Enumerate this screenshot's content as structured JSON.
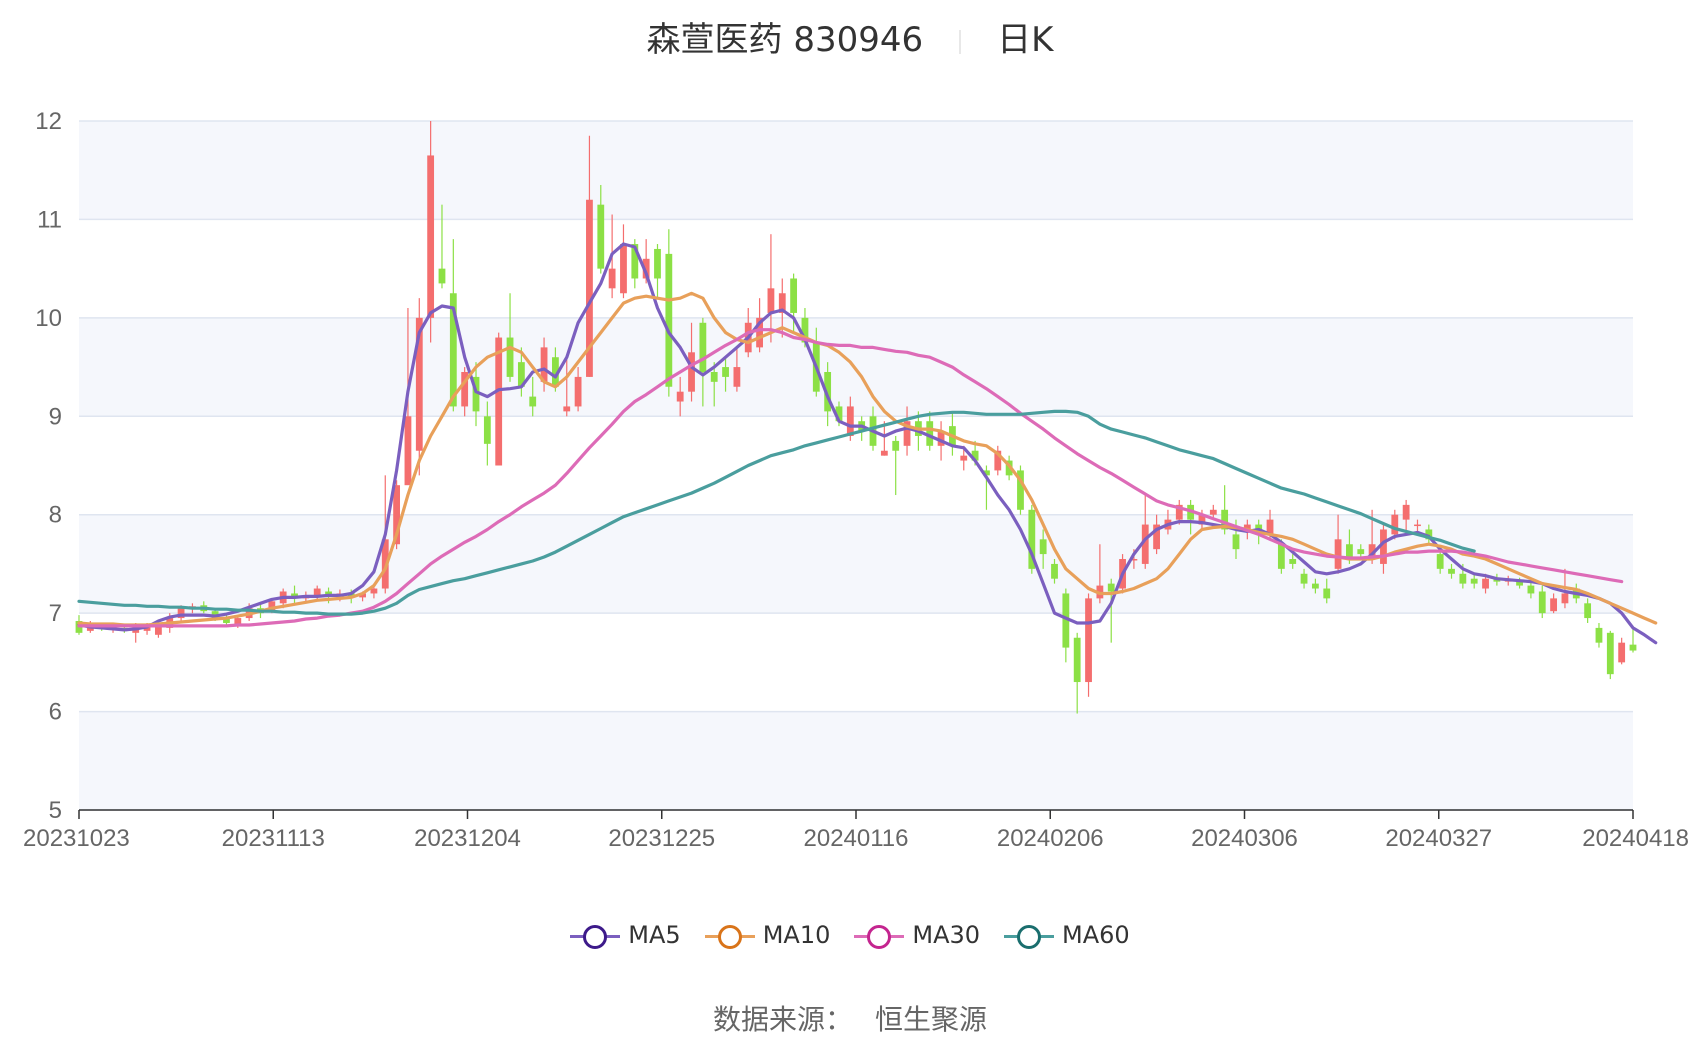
{
  "header": {
    "title": "森萱医药 830946",
    "subtitle": "日K"
  },
  "source": {
    "label": "数据来源：",
    "name": "恒生聚源"
  },
  "colors": {
    "up": "#f46e6e",
    "down": "#8ce045",
    "grid": "#dfe5f0",
    "band": "#f5f7fc",
    "axis": "#666666"
  },
  "chart_data": {
    "type": "candlestick",
    "y_ticks": [
      "5",
      "6",
      "7",
      "8",
      "9",
      "10",
      "11",
      "12"
    ],
    "ylim": [
      5,
      12
    ],
    "x_tick_labels": [
      "20231023",
      "20231113",
      "20231204",
      "20231225",
      "20240116",
      "20240206",
      "20240306",
      "20240327",
      "20240418"
    ],
    "legend": [
      "MA5",
      "MA10",
      "MA30",
      "MA60"
    ],
    "legend_position": "bottom",
    "series_colors": {
      "MA5": "#7b5fbf",
      "MA10": "#e8a05a",
      "MA30": "#dd6bb7",
      "MA60": "#4a9e9e"
    },
    "legend_ring_colors": {
      "MA5": "#3d1a8a",
      "MA10": "#d9741a",
      "MA30": "#c4258f",
      "MA60": "#1a6e6e"
    },
    "candles": [
      [
        6.92,
        6.8,
        6.98,
        6.78
      ],
      [
        6.82,
        6.88,
        6.92,
        6.8
      ],
      [
        6.86,
        6.84,
        6.9,
        6.82
      ],
      [
        6.84,
        6.86,
        6.9,
        6.8
      ],
      [
        6.85,
        6.83,
        6.88,
        6.8
      ],
      [
        6.8,
        6.85,
        6.9,
        6.7
      ],
      [
        6.82,
        6.86,
        6.9,
        6.78
      ],
      [
        6.78,
        6.88,
        6.92,
        6.75
      ],
      [
        6.85,
        6.95,
        7.0,
        6.8
      ],
      [
        6.95,
        7.05,
        7.08,
        6.92
      ],
      [
        7.05,
        7.07,
        7.1,
        7.0
      ],
      [
        7.08,
        7.02,
        7.12,
        7.0
      ],
      [
        7.02,
        6.95,
        7.05,
        6.92
      ],
      [
        6.95,
        6.9,
        6.98,
        6.88
      ],
      [
        6.88,
        6.95,
        6.98,
        6.85
      ],
      [
        6.95,
        7.05,
        7.1,
        6.92
      ],
      [
        7.05,
        7.0,
        7.1,
        6.95
      ],
      [
        7.02,
        7.12,
        7.15,
        7.0
      ],
      [
        7.1,
        7.22,
        7.25,
        7.05
      ],
      [
        7.2,
        7.15,
        7.28,
        7.1
      ],
      [
        7.15,
        7.18,
        7.22,
        7.1
      ],
      [
        7.18,
        7.25,
        7.28,
        7.12
      ],
      [
        7.22,
        7.18,
        7.26,
        7.1
      ],
      [
        7.18,
        7.2,
        7.24,
        7.12
      ],
      [
        7.2,
        7.16,
        7.24,
        7.1
      ],
      [
        7.16,
        7.2,
        7.22,
        7.12
      ],
      [
        7.2,
        7.25,
        7.3,
        7.15
      ],
      [
        7.25,
        7.75,
        8.4,
        7.2
      ],
      [
        7.7,
        8.3,
        8.35,
        7.65
      ],
      [
        8.3,
        9.0,
        10.1,
        8.4
      ],
      [
        8.65,
        10.0,
        10.2,
        8.4
      ],
      [
        10.0,
        11.65,
        12.0,
        9.75
      ],
      [
        10.5,
        10.35,
        11.15,
        10.3
      ],
      [
        10.25,
        9.1,
        10.8,
        9.05
      ],
      [
        9.1,
        9.45,
        9.5,
        9.0
      ],
      [
        9.4,
        9.05,
        9.55,
        8.9
      ],
      [
        9.0,
        8.72,
        9.15,
        8.5
      ],
      [
        8.5,
        9.8,
        9.85,
        8.5
      ],
      [
        9.8,
        9.4,
        10.25,
        9.35
      ],
      [
        9.55,
        9.3,
        9.7,
        9.2
      ],
      [
        9.2,
        9.1,
        9.4,
        9.0
      ],
      [
        9.35,
        9.7,
        9.8,
        9.25
      ],
      [
        9.6,
        9.3,
        9.7,
        9.25
      ],
      [
        9.05,
        9.1,
        9.6,
        9.0
      ],
      [
        9.1,
        9.4,
        9.5,
        9.05
      ],
      [
        9.4,
        11.2,
        11.85,
        9.4
      ],
      [
        11.15,
        10.5,
        11.35,
        10.45
      ],
      [
        10.3,
        10.5,
        11.05,
        10.2
      ],
      [
        10.25,
        10.75,
        10.95,
        10.2
      ],
      [
        10.75,
        10.4,
        10.8,
        10.3
      ],
      [
        10.4,
        10.6,
        10.8,
        10.35
      ],
      [
        10.7,
        10.4,
        10.75,
        10.2
      ],
      [
        10.65,
        9.3,
        10.9,
        9.2
      ],
      [
        9.15,
        9.25,
        9.4,
        9.0
      ],
      [
        9.25,
        9.65,
        9.95,
        9.15
      ],
      [
        9.95,
        9.45,
        10.0,
        9.1
      ],
      [
        9.45,
        9.35,
        9.55,
        9.1
      ],
      [
        9.5,
        9.4,
        9.6,
        9.25
      ],
      [
        9.3,
        9.5,
        9.7,
        9.25
      ],
      [
        9.65,
        9.95,
        10.1,
        9.6
      ],
      [
        9.7,
        10.0,
        10.2,
        9.65
      ],
      [
        10.05,
        10.3,
        10.85,
        9.75
      ],
      [
        10.05,
        10.25,
        10.4,
        9.8
      ],
      [
        10.4,
        10.05,
        10.45,
        9.85
      ],
      [
        10.0,
        9.75,
        10.1,
        9.7
      ],
      [
        9.75,
        9.25,
        9.9,
        9.2
      ],
      [
        9.45,
        9.05,
        9.55,
        8.9
      ],
      [
        9.1,
        8.95,
        9.15,
        8.9
      ],
      [
        8.8,
        9.1,
        9.2,
        8.75
      ],
      [
        8.95,
        8.85,
        9.0,
        8.75
      ],
      [
        9.0,
        8.7,
        9.1,
        8.65
      ],
      [
        8.6,
        8.65,
        8.95,
        8.6
      ],
      [
        8.75,
        8.65,
        8.8,
        8.2
      ],
      [
        8.7,
        8.95,
        9.1,
        8.6
      ],
      [
        8.95,
        8.8,
        9.05,
        8.65
      ],
      [
        8.95,
        8.7,
        9.05,
        8.65
      ],
      [
        8.7,
        8.85,
        8.95,
        8.55
      ],
      [
        8.9,
        8.7,
        9.05,
        8.6
      ],
      [
        8.55,
        8.6,
        8.7,
        8.45
      ],
      [
        8.65,
        8.55,
        8.75,
        8.5
      ],
      [
        8.45,
        8.4,
        8.5,
        8.05
      ],
      [
        8.45,
        8.65,
        8.7,
        8.4
      ],
      [
        8.55,
        8.4,
        8.6,
        8.35
      ],
      [
        8.45,
        8.05,
        8.5,
        8.0
      ],
      [
        8.05,
        7.45,
        8.1,
        7.4
      ],
      [
        7.75,
        7.6,
        7.85,
        7.45
      ],
      [
        7.5,
        7.35,
        7.55,
        7.3
      ],
      [
        7.2,
        6.65,
        7.25,
        6.5
      ],
      [
        6.75,
        6.3,
        6.8,
        5.98
      ],
      [
        6.3,
        7.15,
        7.2,
        6.15
      ],
      [
        7.15,
        7.28,
        7.7,
        7.1
      ],
      [
        7.3,
        7.22,
        7.35,
        6.7
      ],
      [
        7.25,
        7.55,
        7.6,
        7.2
      ],
      [
        7.55,
        7.55,
        7.65,
        7.45
      ],
      [
        7.5,
        7.9,
        8.2,
        7.45
      ],
      [
        7.65,
        7.9,
        8.0,
        7.6
      ],
      [
        7.85,
        7.95,
        8.05,
        7.8
      ],
      [
        7.95,
        8.1,
        8.15,
        7.9
      ],
      [
        8.1,
        7.95,
        8.15,
        7.8
      ],
      [
        7.9,
        8.0,
        8.05,
        7.85
      ],
      [
        8.0,
        8.05,
        8.1,
        7.95
      ],
      [
        8.05,
        7.85,
        8.3,
        7.8
      ],
      [
        7.8,
        7.65,
        7.95,
        7.55
      ],
      [
        7.85,
        7.9,
        7.95,
        7.75
      ],
      [
        7.9,
        7.8,
        7.95,
        7.7
      ],
      [
        7.8,
        7.95,
        8.05,
        7.75
      ],
      [
        7.7,
        7.45,
        7.75,
        7.4
      ],
      [
        7.55,
        7.5,
        7.6,
        7.45
      ],
      [
        7.4,
        7.3,
        7.45,
        7.25
      ],
      [
        7.3,
        7.25,
        7.35,
        7.2
      ],
      [
        7.25,
        7.15,
        7.35,
        7.1
      ],
      [
        7.45,
        7.75,
        8.0,
        7.4
      ],
      [
        7.7,
        7.55,
        7.85,
        7.5
      ],
      [
        7.65,
        7.6,
        7.7,
        7.55
      ],
      [
        7.55,
        7.7,
        8.05,
        7.5
      ],
      [
        7.5,
        7.85,
        7.9,
        7.4
      ],
      [
        7.8,
        8.0,
        8.05,
        7.75
      ],
      [
        7.95,
        8.1,
        8.15,
        7.8
      ],
      [
        7.9,
        7.9,
        7.95,
        7.8
      ],
      [
        7.85,
        7.75,
        7.9,
        7.7
      ],
      [
        7.6,
        7.45,
        7.65,
        7.4
      ],
      [
        7.45,
        7.4,
        7.5,
        7.35
      ],
      [
        7.4,
        7.3,
        7.5,
        7.25
      ],
      [
        7.35,
        7.3,
        7.4,
        7.25
      ],
      [
        7.25,
        7.35,
        7.4,
        7.2
      ],
      [
        7.35,
        7.32,
        7.4,
        7.28
      ],
      [
        7.32,
        7.35,
        7.38,
        7.28
      ],
      [
        7.33,
        7.28,
        7.36,
        7.25
      ],
      [
        7.28,
        7.2,
        7.32,
        7.15
      ],
      [
        7.22,
        7.0,
        7.28,
        6.95
      ],
      [
        7.02,
        7.15,
        7.2,
        7.0
      ],
      [
        7.1,
        7.2,
        7.45,
        7.05
      ],
      [
        7.25,
        7.15,
        7.3,
        7.1
      ],
      [
        7.1,
        6.95,
        7.15,
        6.9
      ],
      [
        6.85,
        6.7,
        6.9,
        6.65
      ],
      [
        6.8,
        6.38,
        6.82,
        6.33
      ],
      [
        6.5,
        6.7,
        6.75,
        6.48
      ],
      [
        6.68,
        6.62,
        6.85,
        6.6
      ]
    ],
    "series": [
      {
        "name": "MA5",
        "values": [
          6.88,
          6.86,
          6.85,
          6.84,
          6.83,
          6.84,
          6.86,
          6.92,
          6.96,
          6.98,
          6.98,
          6.98,
          6.97,
          6.99,
          7.02,
          7.06,
          7.1,
          7.14,
          7.16,
          7.16,
          7.17,
          7.17,
          7.18,
          7.18,
          7.2,
          7.28,
          7.42,
          7.8,
          8.45,
          9.25,
          9.85,
          10.05,
          10.12,
          10.1,
          9.6,
          9.25,
          9.2,
          9.27,
          9.28,
          9.3,
          9.45,
          9.48,
          9.4,
          9.6,
          9.95,
          10.15,
          10.35,
          10.65,
          10.75,
          10.72,
          10.45,
          10.1,
          9.85,
          9.7,
          9.5,
          9.42,
          9.5,
          9.6,
          9.7,
          9.8,
          9.95,
          10.05,
          10.08,
          10.0,
          9.78,
          9.5,
          9.2,
          8.95,
          8.9,
          8.9,
          8.85,
          8.8,
          8.85,
          8.88,
          8.85,
          8.8,
          8.75,
          8.7,
          8.68,
          8.55,
          8.38,
          8.2,
          8.05,
          7.85,
          7.6,
          7.3,
          7.0,
          6.95,
          6.9,
          6.9,
          6.92,
          7.1,
          7.4,
          7.6,
          7.75,
          7.85,
          7.9,
          7.93,
          7.93,
          7.92,
          7.9,
          7.88,
          7.85,
          7.83,
          7.85,
          7.8,
          7.72,
          7.62,
          7.52,
          7.42,
          7.4,
          7.42,
          7.45,
          7.5,
          7.6,
          7.72,
          7.78,
          7.8,
          7.82,
          7.78,
          7.65,
          7.55,
          7.45,
          7.4,
          7.38,
          7.35,
          7.34,
          7.33,
          7.32,
          7.3,
          7.25,
          7.22,
          7.2,
          7.18,
          7.15,
          7.1,
          7.0,
          6.85,
          6.78,
          6.7
        ]
      },
      {
        "name": "MA10",
        "values": [
          6.9,
          6.89,
          6.89,
          6.89,
          6.88,
          6.88,
          6.88,
          6.89,
          6.9,
          6.91,
          6.92,
          6.93,
          6.94,
          6.95,
          6.97,
          6.99,
          7.02,
          7.05,
          7.07,
          7.09,
          7.11,
          7.13,
          7.14,
          7.15,
          7.16,
          7.2,
          7.28,
          7.45,
          7.8,
          8.2,
          8.55,
          8.8,
          9.0,
          9.2,
          9.35,
          9.5,
          9.6,
          9.65,
          9.7,
          9.65,
          9.5,
          9.35,
          9.3,
          9.4,
          9.55,
          9.7,
          9.85,
          10.0,
          10.15,
          10.2,
          10.22,
          10.2,
          10.18,
          10.2,
          10.25,
          10.2,
          10.0,
          9.85,
          9.78,
          9.75,
          9.8,
          9.85,
          9.9,
          9.85,
          9.8,
          9.75,
          9.72,
          9.65,
          9.55,
          9.4,
          9.2,
          9.05,
          8.95,
          8.9,
          8.87,
          8.87,
          8.85,
          8.8,
          8.75,
          8.72,
          8.7,
          8.62,
          8.5,
          8.35,
          8.15,
          7.9,
          7.65,
          7.45,
          7.35,
          7.25,
          7.2,
          7.2,
          7.22,
          7.25,
          7.3,
          7.35,
          7.45,
          7.6,
          7.75,
          7.85,
          7.87,
          7.88,
          7.87,
          7.85,
          7.82,
          7.8,
          7.78,
          7.75,
          7.7,
          7.65,
          7.6,
          7.57,
          7.55,
          7.55,
          7.55,
          7.58,
          7.62,
          7.65,
          7.68,
          7.7,
          7.68,
          7.65,
          7.6,
          7.58,
          7.55,
          7.5,
          7.45,
          7.4,
          7.35,
          7.3,
          7.28,
          7.26,
          7.24,
          7.2,
          7.15,
          7.1,
          7.05,
          7.0,
          6.95,
          6.9
        ]
      },
      {
        "name": "MA30",
        "values": [
          6.87,
          6.87,
          6.87,
          6.87,
          6.87,
          6.87,
          6.87,
          6.87,
          6.87,
          6.87,
          6.87,
          6.87,
          6.87,
          6.87,
          6.88,
          6.88,
          6.89,
          6.9,
          6.91,
          6.92,
          6.94,
          6.95,
          6.97,
          6.98,
          7.0,
          7.02,
          7.06,
          7.12,
          7.2,
          7.3,
          7.4,
          7.5,
          7.58,
          7.65,
          7.72,
          7.78,
          7.85,
          7.93,
          8.0,
          8.08,
          8.15,
          8.22,
          8.3,
          8.42,
          8.55,
          8.68,
          8.8,
          8.92,
          9.05,
          9.15,
          9.22,
          9.3,
          9.38,
          9.45,
          9.52,
          9.58,
          9.65,
          9.72,
          9.78,
          9.85,
          9.88,
          9.88,
          9.85,
          9.8,
          9.78,
          9.75,
          9.73,
          9.72,
          9.72,
          9.7,
          9.7,
          9.68,
          9.66,
          9.65,
          9.62,
          9.6,
          9.55,
          9.5,
          9.42,
          9.35,
          9.28,
          9.2,
          9.12,
          9.03,
          8.95,
          8.87,
          8.78,
          8.7,
          8.62,
          8.55,
          8.48,
          8.42,
          8.35,
          8.28,
          8.21,
          8.14,
          8.1,
          8.07,
          8.04,
          8.0,
          7.96,
          7.92,
          7.88,
          7.84,
          7.8,
          7.75,
          7.7,
          7.65,
          7.62,
          7.6,
          7.58,
          7.57,
          7.56,
          7.56,
          7.57,
          7.58,
          7.6,
          7.62,
          7.62,
          7.63,
          7.63,
          7.63,
          7.62,
          7.6,
          7.58,
          7.55,
          7.52,
          7.5,
          7.48,
          7.46,
          7.44,
          7.42,
          7.4,
          7.38,
          7.36,
          7.34,
          7.32
        ]
      },
      {
        "name": "MA60",
        "values": [
          7.12,
          7.11,
          7.1,
          7.09,
          7.08,
          7.08,
          7.07,
          7.07,
          7.06,
          7.06,
          7.05,
          7.05,
          7.04,
          7.04,
          7.03,
          7.03,
          7.02,
          7.02,
          7.01,
          7.01,
          7.0,
          7.0,
          6.99,
          6.99,
          6.99,
          7.0,
          7.02,
          7.05,
          7.1,
          7.18,
          7.24,
          7.27,
          7.3,
          7.33,
          7.35,
          7.38,
          7.41,
          7.44,
          7.47,
          7.5,
          7.53,
          7.57,
          7.62,
          7.68,
          7.74,
          7.8,
          7.86,
          7.92,
          7.98,
          8.02,
          8.06,
          8.1,
          8.14,
          8.18,
          8.22,
          8.27,
          8.32,
          8.38,
          8.44,
          8.5,
          8.55,
          8.6,
          8.63,
          8.66,
          8.7,
          8.73,
          8.76,
          8.79,
          8.82,
          8.85,
          8.88,
          8.91,
          8.94,
          8.97,
          9.0,
          9.02,
          9.03,
          9.04,
          9.04,
          9.03,
          9.02,
          9.02,
          9.02,
          9.02,
          9.03,
          9.04,
          9.05,
          9.05,
          9.04,
          9.0,
          8.92,
          8.87,
          8.84,
          8.81,
          8.78,
          8.74,
          8.7,
          8.66,
          8.63,
          8.6,
          8.57,
          8.52,
          8.47,
          8.42,
          8.37,
          8.32,
          8.27,
          8.24,
          8.21,
          8.17,
          8.13,
          8.09,
          8.05,
          8.01,
          7.96,
          7.91,
          7.86,
          7.83,
          7.8,
          7.77,
          7.74,
          7.7,
          7.66,
          7.63
        ]
      }
    ]
  }
}
